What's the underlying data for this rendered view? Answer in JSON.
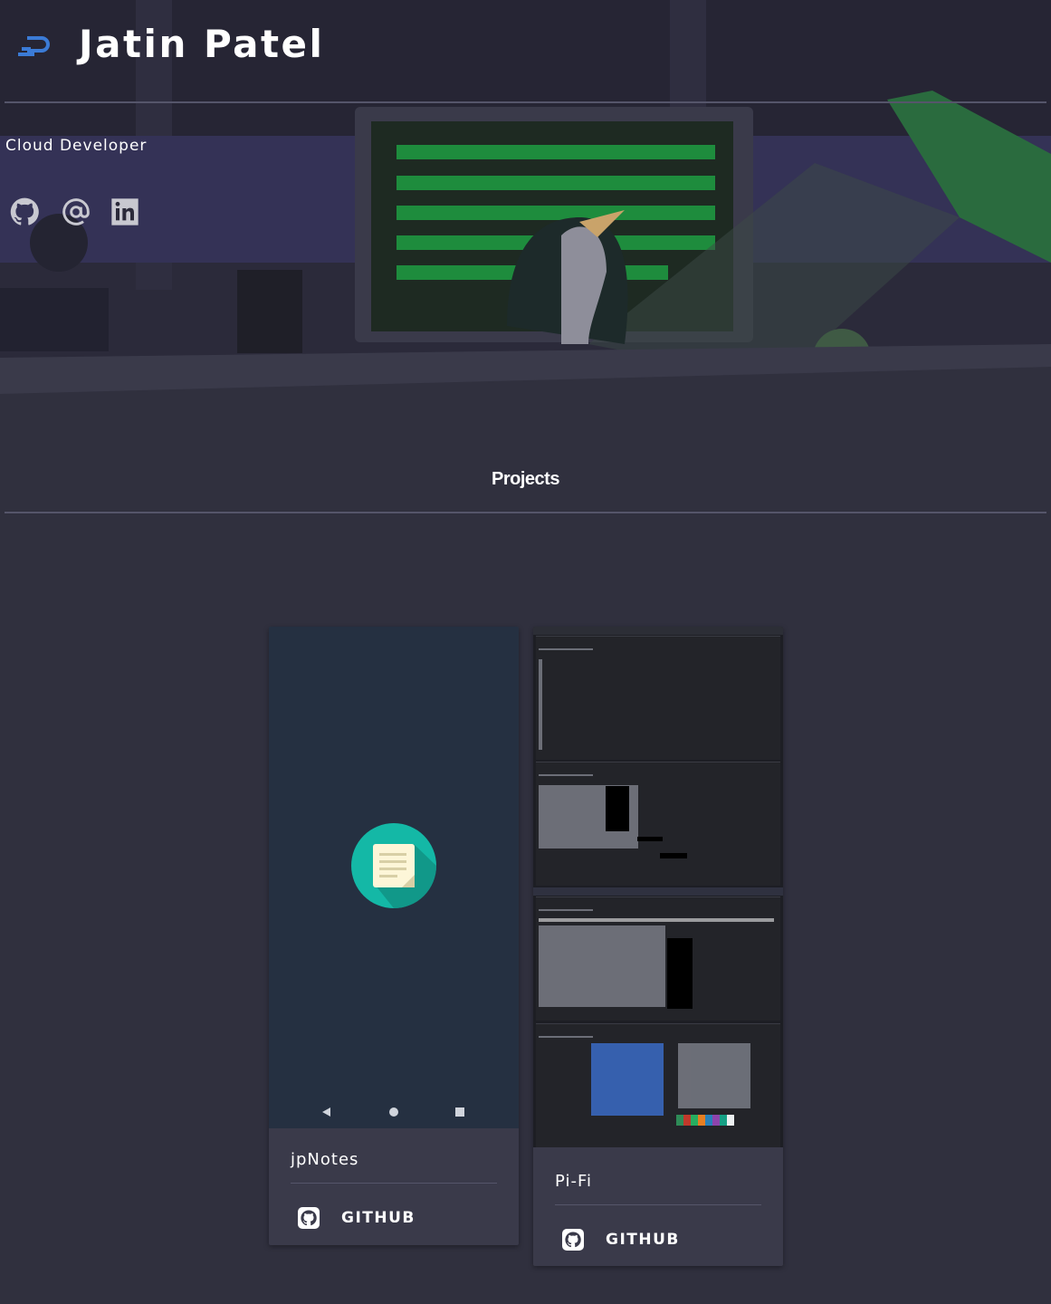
{
  "header": {
    "logo_text": "JP",
    "name": "Jatin Patel",
    "subtitle": "Cloud Developer"
  },
  "social": [
    {
      "icon": "github-icon"
    },
    {
      "icon": "at-sign-icon"
    },
    {
      "icon": "linkedin-icon"
    }
  ],
  "projects": {
    "heading": "Projects",
    "items": [
      {
        "name": "jpNotes",
        "button_label": "GITHUB"
      },
      {
        "name": "Pi-Fi",
        "button_label": "GITHUB"
      }
    ]
  },
  "colors": {
    "background": "#30303e",
    "accent_green": "#1e7a3a",
    "logo_blue": "#3b7bd6",
    "notes_teal": "#14b8a6"
  }
}
